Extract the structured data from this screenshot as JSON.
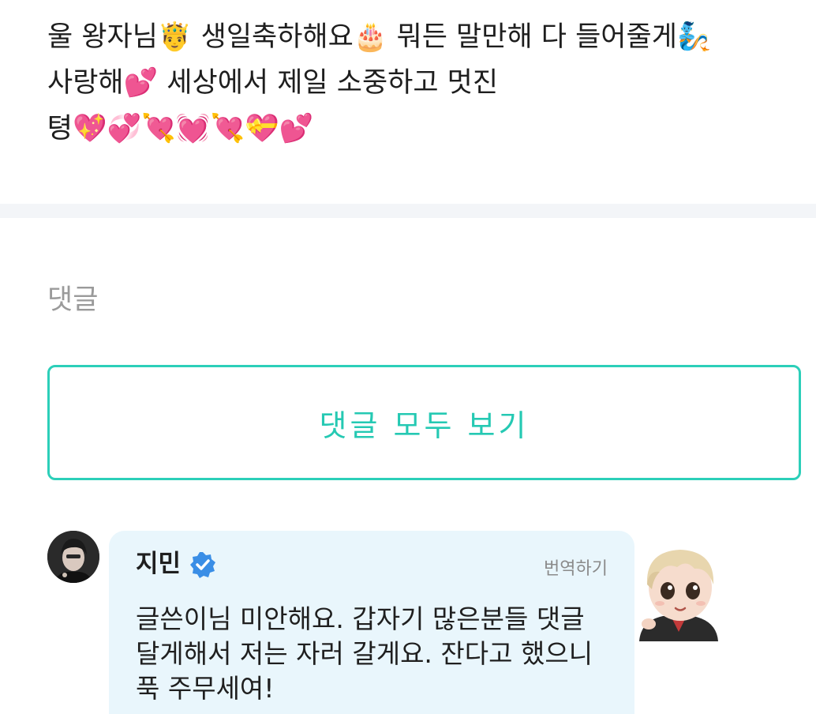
{
  "post": {
    "lines": [
      "울 왕자님🤴 생일축하해요🎂 뭐든 말만해 다 들어줄게🧞",
      "사랑해💕 세상에서 제일 소중하고 멋진",
      "텽💖💞💘💓💘💝💕"
    ]
  },
  "comments_section": {
    "heading": "댓글",
    "view_all_label": "댓글 모두 보기"
  },
  "comment": {
    "author": "지민",
    "verified": true,
    "translate_label": "번역하기",
    "text_lines": [
      "글쓴이님 미안해요. 갑자기 많은분들 댓글",
      "달게해서 저는 자러 갈게요. 잔다고 했으니",
      "푹 주무세여!"
    ]
  },
  "colors": {
    "accent": "#25c9b3",
    "bubble": "#e9f6fc",
    "verified": "#3a8ee6"
  }
}
